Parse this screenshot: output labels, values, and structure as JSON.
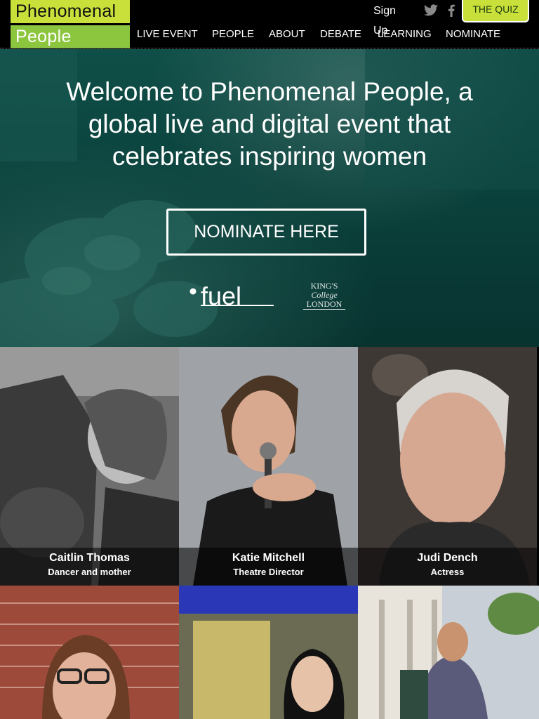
{
  "header": {
    "logo_top": "Phenomenal",
    "logo_bottom": "People",
    "nav": [
      "LIVE EVENT",
      "PEOPLE",
      "ABOUT",
      "DEBATE",
      "LEARNING",
      "NOMINATE"
    ],
    "signup": "Sign Up",
    "quiz": "THE QUIZ",
    "icons": [
      "twitter-icon",
      "facebook-icon"
    ]
  },
  "hero": {
    "title": "Welcome to Phenomenal People, a global live and digital event that celebrates inspiring women",
    "cta": "NOMINATE HERE",
    "partners": {
      "fuel": "fuel",
      "kings_line1": "KING'S",
      "kings_line2": "College",
      "kings_line3": "LONDON"
    }
  },
  "people": [
    {
      "name": "Caitlin Thomas",
      "role": "Dancer and mother"
    },
    {
      "name": "Katie Mitchell",
      "role": "Theatre Director"
    },
    {
      "name": "Judi Dench",
      "role": "Actress"
    },
    {
      "name": "",
      "role": ""
    },
    {
      "name": "",
      "role": ""
    },
    {
      "name": "",
      "role": ""
    }
  ],
  "colors": {
    "lime": "#c9e03a",
    "green": "#8cc63f",
    "teal": "#0a3f3a",
    "black": "#000000"
  }
}
